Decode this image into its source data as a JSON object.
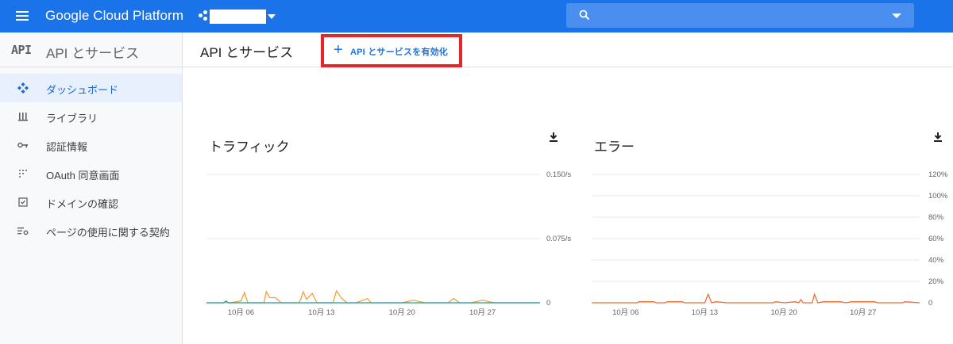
{
  "topbar": {
    "brand": "Google Cloud Platform",
    "search": {
      "placeholder": ""
    },
    "colors": {
      "bar": "#1a73e8"
    }
  },
  "sidebar": {
    "api_logo": "API",
    "title": "API とサービス",
    "items": [
      {
        "label": "ダッシュボード",
        "icon": "dashboard-icon",
        "active": true
      },
      {
        "label": "ライブラリ",
        "icon": "library-icon",
        "active": false
      },
      {
        "label": "認証情報",
        "icon": "key-icon",
        "active": false
      },
      {
        "label": "OAuth 同意画面",
        "icon": "consent-icon",
        "active": false
      },
      {
        "label": "ドメインの確認",
        "icon": "checkbox-icon",
        "active": false
      },
      {
        "label": "ページの使用に関する契約",
        "icon": "settings-list-icon",
        "active": false
      }
    ]
  },
  "main": {
    "title": "API とサービス",
    "enable_button": {
      "plus": "+",
      "label": "API とサービスを有効化",
      "highlight_color": "#e8232a"
    }
  },
  "chart_data": [
    {
      "type": "line",
      "title": "トラフィック",
      "xlabel": "",
      "ylabel": "",
      "x_ticks": [
        "10月 06",
        "10月 13",
        "10月 20",
        "10月 27"
      ],
      "y_ticks": [
        "0.150/s",
        "0.075/s",
        "0"
      ],
      "ylim": [
        0,
        0.15
      ],
      "series": [
        {
          "color": "#f4a03a",
          "points": [
            [
              0,
              0
            ],
            [
              2,
              0
            ],
            [
              3,
              0.002
            ],
            [
              3.3,
              0.012
            ],
            [
              3.6,
              0
            ],
            [
              5,
              0
            ],
            [
              5.2,
              0.013
            ],
            [
              5.5,
              0.006
            ],
            [
              6,
              0.006
            ],
            [
              6.5,
              0
            ],
            [
              8,
              0
            ],
            [
              8.2,
              0.004
            ],
            [
              8.4,
              0.013
            ],
            [
              8.7,
              0.004
            ],
            [
              9.2,
              0.011
            ],
            [
              9.6,
              0
            ],
            [
              11,
              0
            ],
            [
              11.3,
              0.014
            ],
            [
              11.7,
              0.006
            ],
            [
              12.2,
              0
            ],
            [
              13,
              0
            ],
            [
              14,
              0.005
            ],
            [
              14.3,
              0
            ],
            [
              17,
              0
            ],
            [
              18,
              0.003
            ],
            [
              19,
              0
            ],
            [
              21,
              0
            ],
            [
              21.5,
              0.005
            ],
            [
              22,
              0
            ],
            [
              23,
              0
            ],
            [
              24,
              0.003
            ],
            [
              25,
              0
            ],
            [
              29,
              0
            ]
          ]
        },
        {
          "color": "#12a4af",
          "points": [
            [
              0,
              0
            ],
            [
              1.5,
              0
            ],
            [
              1.7,
              0.002
            ],
            [
              1.9,
              0
            ],
            [
              29,
              0
            ]
          ]
        }
      ]
    },
    {
      "type": "line",
      "title": "エラー",
      "xlabel": "",
      "ylabel": "",
      "x_ticks": [
        "10月 06",
        "10月 13",
        "10月 20",
        "10月 27"
      ],
      "y_ticks": [
        "120%",
        "100%",
        "80%",
        "60%",
        "40%",
        "20%",
        "0"
      ],
      "ylim": [
        0,
        120
      ],
      "series": [
        {
          "color": "#f07030",
          "points": [
            [
              0,
              0
            ],
            [
              4,
              0
            ],
            [
              4.2,
              1
            ],
            [
              5.5,
              1
            ],
            [
              5.7,
              0
            ],
            [
              6.5,
              0
            ],
            [
              6.7,
              1
            ],
            [
              8,
              1
            ],
            [
              8.2,
              0
            ],
            [
              10,
              0
            ],
            [
              10.3,
              8
            ],
            [
              10.6,
              0
            ],
            [
              11,
              1
            ],
            [
              12,
              0
            ],
            [
              16,
              0
            ],
            [
              16.3,
              1
            ],
            [
              17,
              0
            ],
            [
              18,
              1
            ],
            [
              18.3,
              0
            ],
            [
              18.5,
              3
            ],
            [
              18.7,
              0
            ],
            [
              19.5,
              0
            ],
            [
              19.7,
              8
            ],
            [
              20,
              0
            ],
            [
              20.5,
              1
            ],
            [
              22,
              1
            ],
            [
              22.5,
              0
            ],
            [
              23,
              1
            ],
            [
              25,
              1
            ],
            [
              25.3,
              0
            ],
            [
              27.5,
              0
            ],
            [
              27.7,
              1
            ],
            [
              29,
              0
            ]
          ]
        }
      ]
    }
  ]
}
